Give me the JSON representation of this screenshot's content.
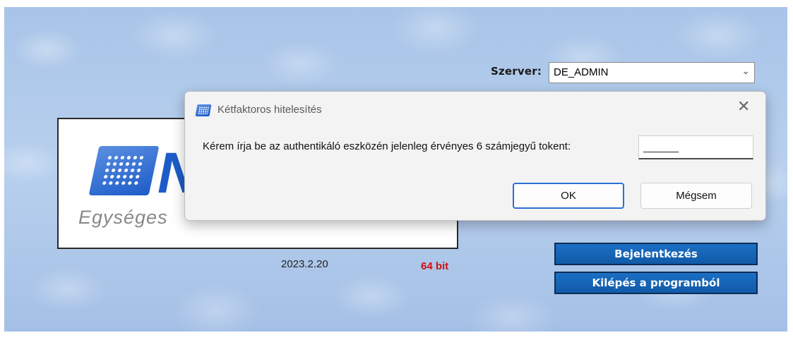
{
  "server": {
    "label": "Szerver:",
    "value": "DE_ADMIN"
  },
  "logo": {
    "letter": "N",
    "subtitle": "Egységes"
  },
  "version": "2023.2.20",
  "bits": "64 bit",
  "buttons": {
    "login": "Bejelentkezés",
    "exit": "Kilépés a programból"
  },
  "dialog": {
    "title": "Kétfaktoros hitelesítés",
    "prompt": "Kérem írja be az authentikáló eszközén jelenleg érvényes 6 számjegyű tokent:",
    "input_value": "______",
    "ok": "OK",
    "cancel": "Mégsem",
    "close_glyph": "✕"
  },
  "colors": {
    "accent_button": "#1564b6",
    "bits_red": "#d01010",
    "logo_blue": "#1d5cc8",
    "background": "#b3cceb"
  },
  "icons": [
    "chevron-down-icon",
    "close-icon",
    "app-logo-icon"
  ]
}
